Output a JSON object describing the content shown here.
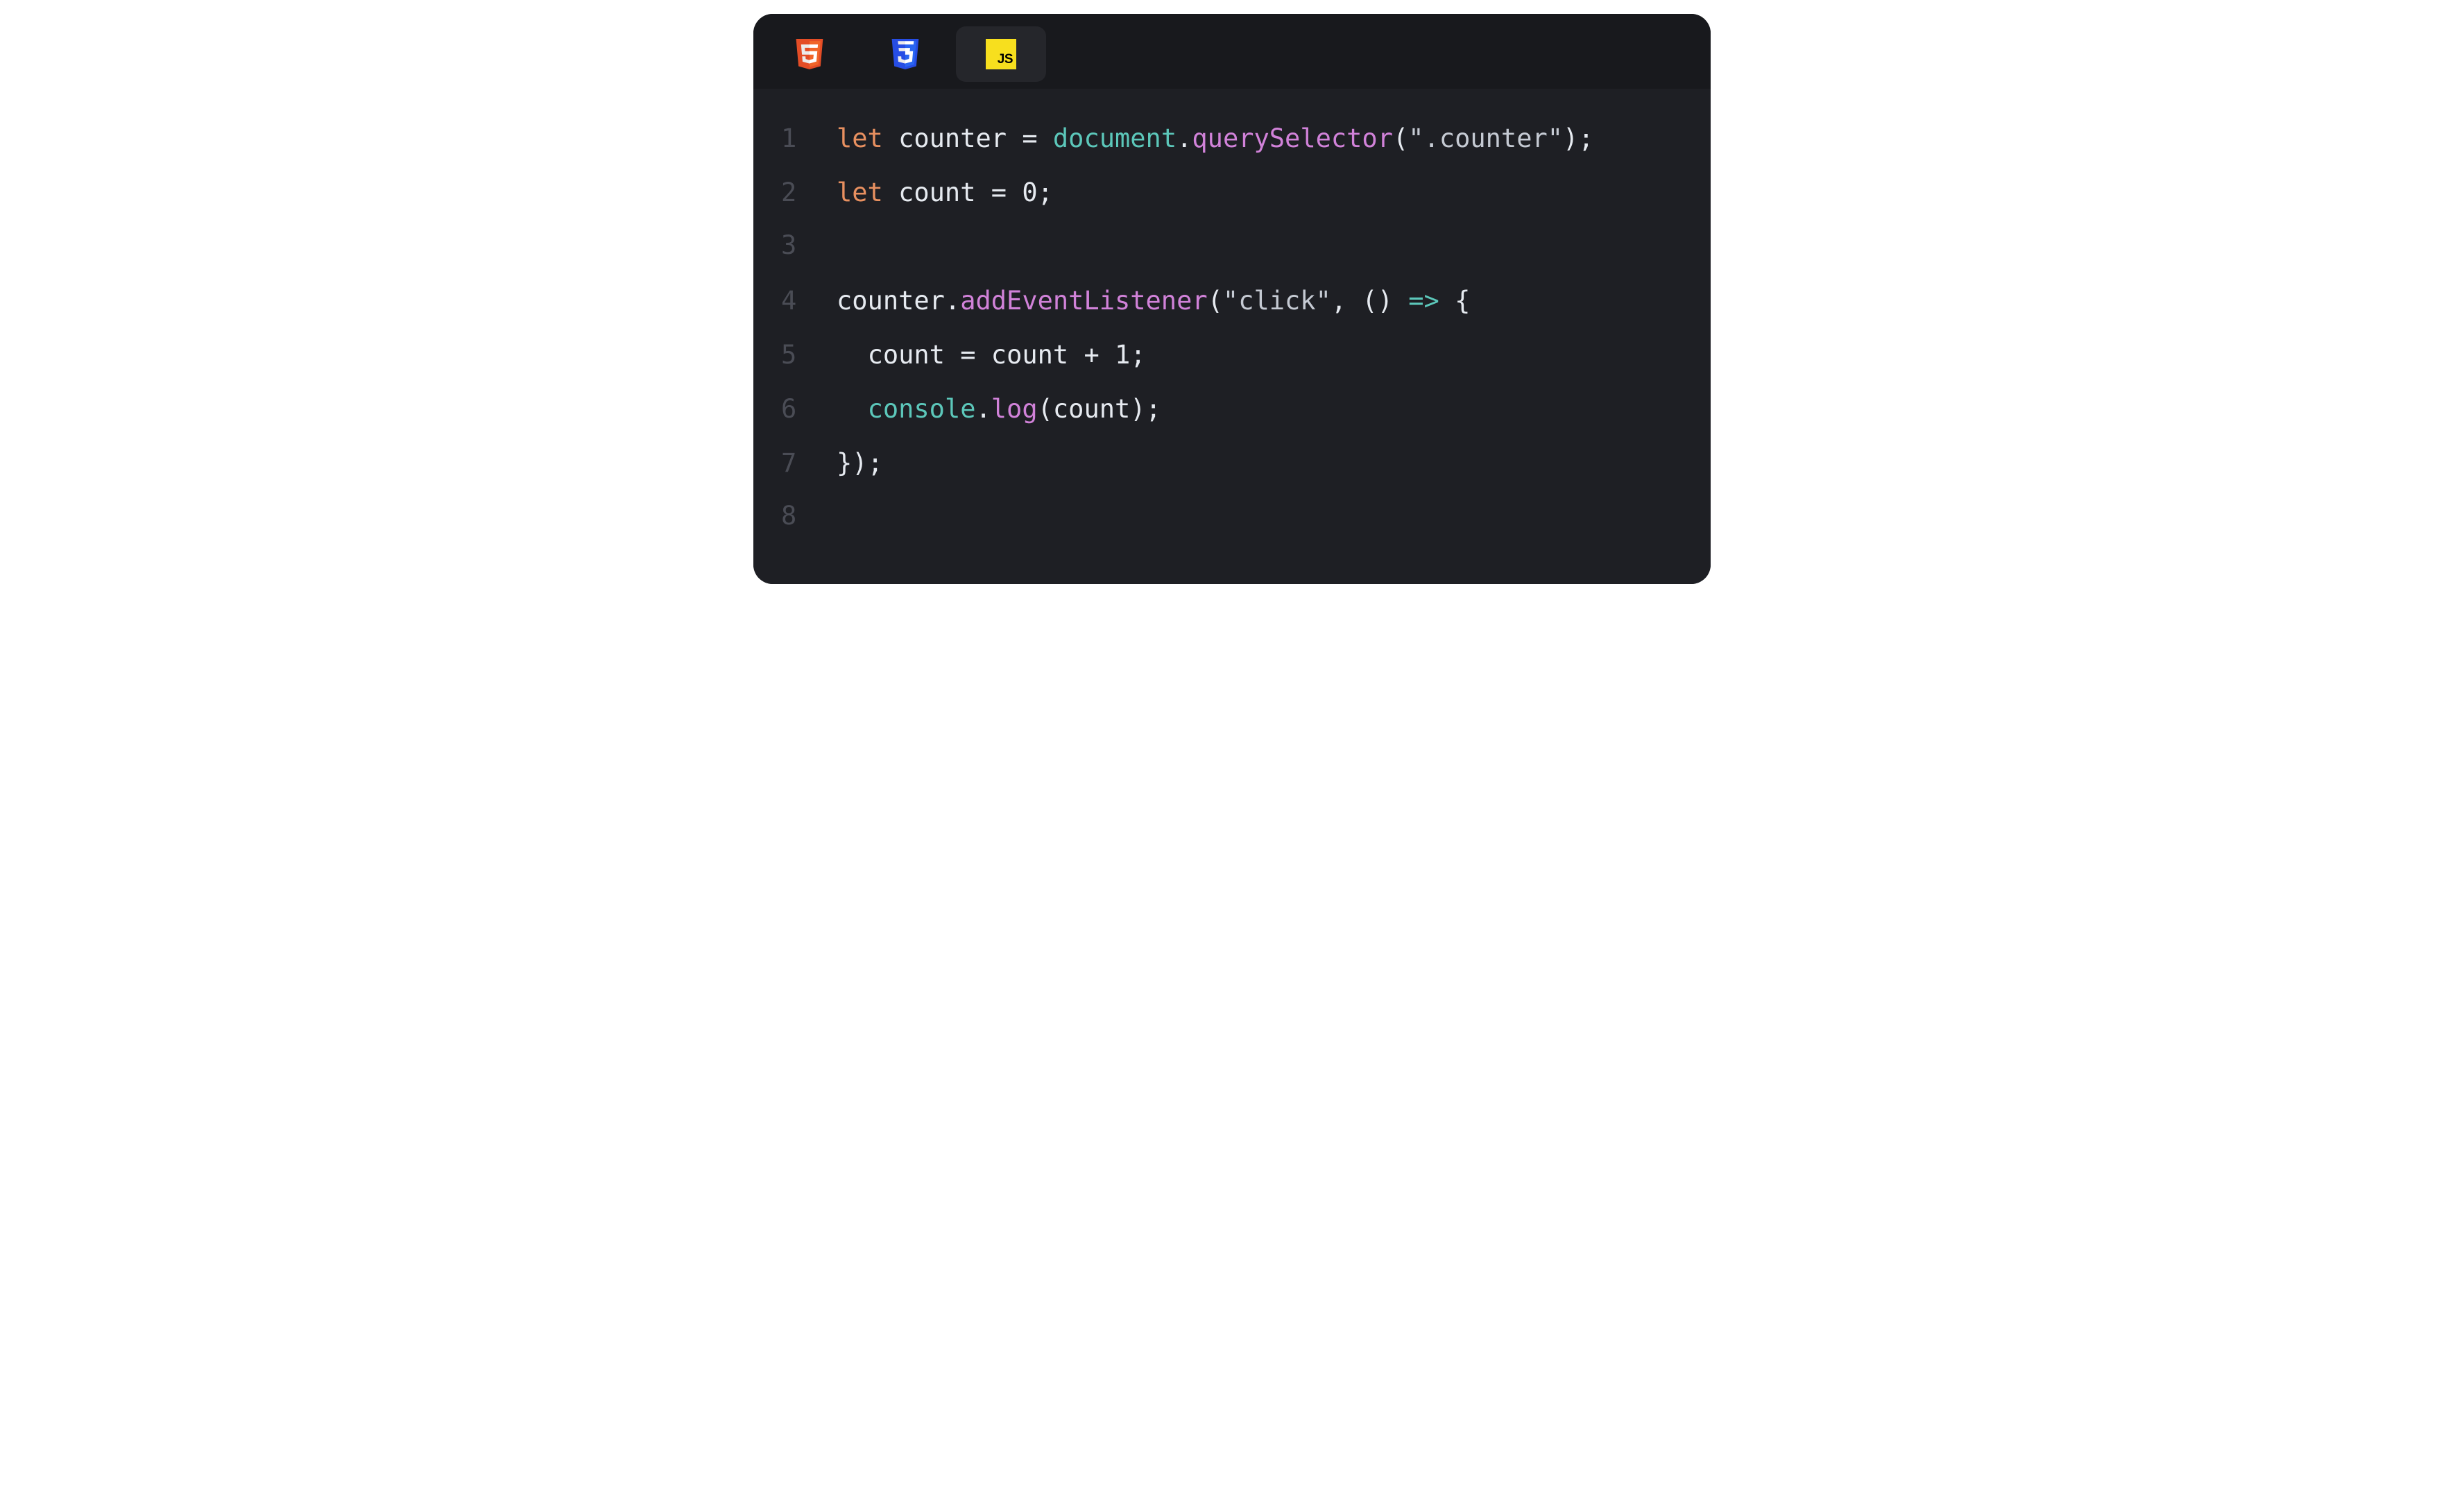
{
  "tabs": [
    {
      "id": "html",
      "icon": "html5-icon",
      "active": false
    },
    {
      "id": "css",
      "icon": "css3-icon",
      "active": false
    },
    {
      "id": "js",
      "icon": "js-icon",
      "label": "JS",
      "active": true
    }
  ],
  "lineNumbers": [
    "1",
    "2",
    "3",
    "4",
    "5",
    "6",
    "7",
    "8"
  ],
  "code": {
    "l1": {
      "let": "let",
      "sp1": " ",
      "var": "counter",
      "sp2": " ",
      "eq": "=",
      "sp3": " ",
      "doc": "document",
      "dot": ".",
      "fn": "querySelector",
      "open": "(",
      "str": "\".counter\"",
      "close": ");"
    },
    "l2": {
      "let": "let",
      "sp1": " ",
      "var": "count",
      "sp2": " ",
      "eq": "=",
      "sp3": " ",
      "num": "0",
      "semi": ";"
    },
    "l3": {
      "empty": ""
    },
    "l4": {
      "var": "counter",
      "dot": ".",
      "fn": "addEventListener",
      "open": "(",
      "str": "\"click\"",
      "comma": ",",
      "sp1": " ",
      "paren": "()",
      "sp2": " ",
      "arrow": "=>",
      "sp3": " ",
      "brace": "{"
    },
    "l5": {
      "indent": "  ",
      "lhs": "count",
      "sp1": " ",
      "eq": "=",
      "sp2": " ",
      "rhs1": "count",
      "sp3": " ",
      "plus": "+",
      "sp4": " ",
      "num": "1",
      "semi": ";"
    },
    "l6": {
      "indent": "  ",
      "cons": "console",
      "dot": ".",
      "fn": "log",
      "open": "(",
      "arg": "count",
      "close": ");"
    },
    "l7": {
      "close": "});"
    },
    "l8": {
      "empty": ""
    }
  }
}
